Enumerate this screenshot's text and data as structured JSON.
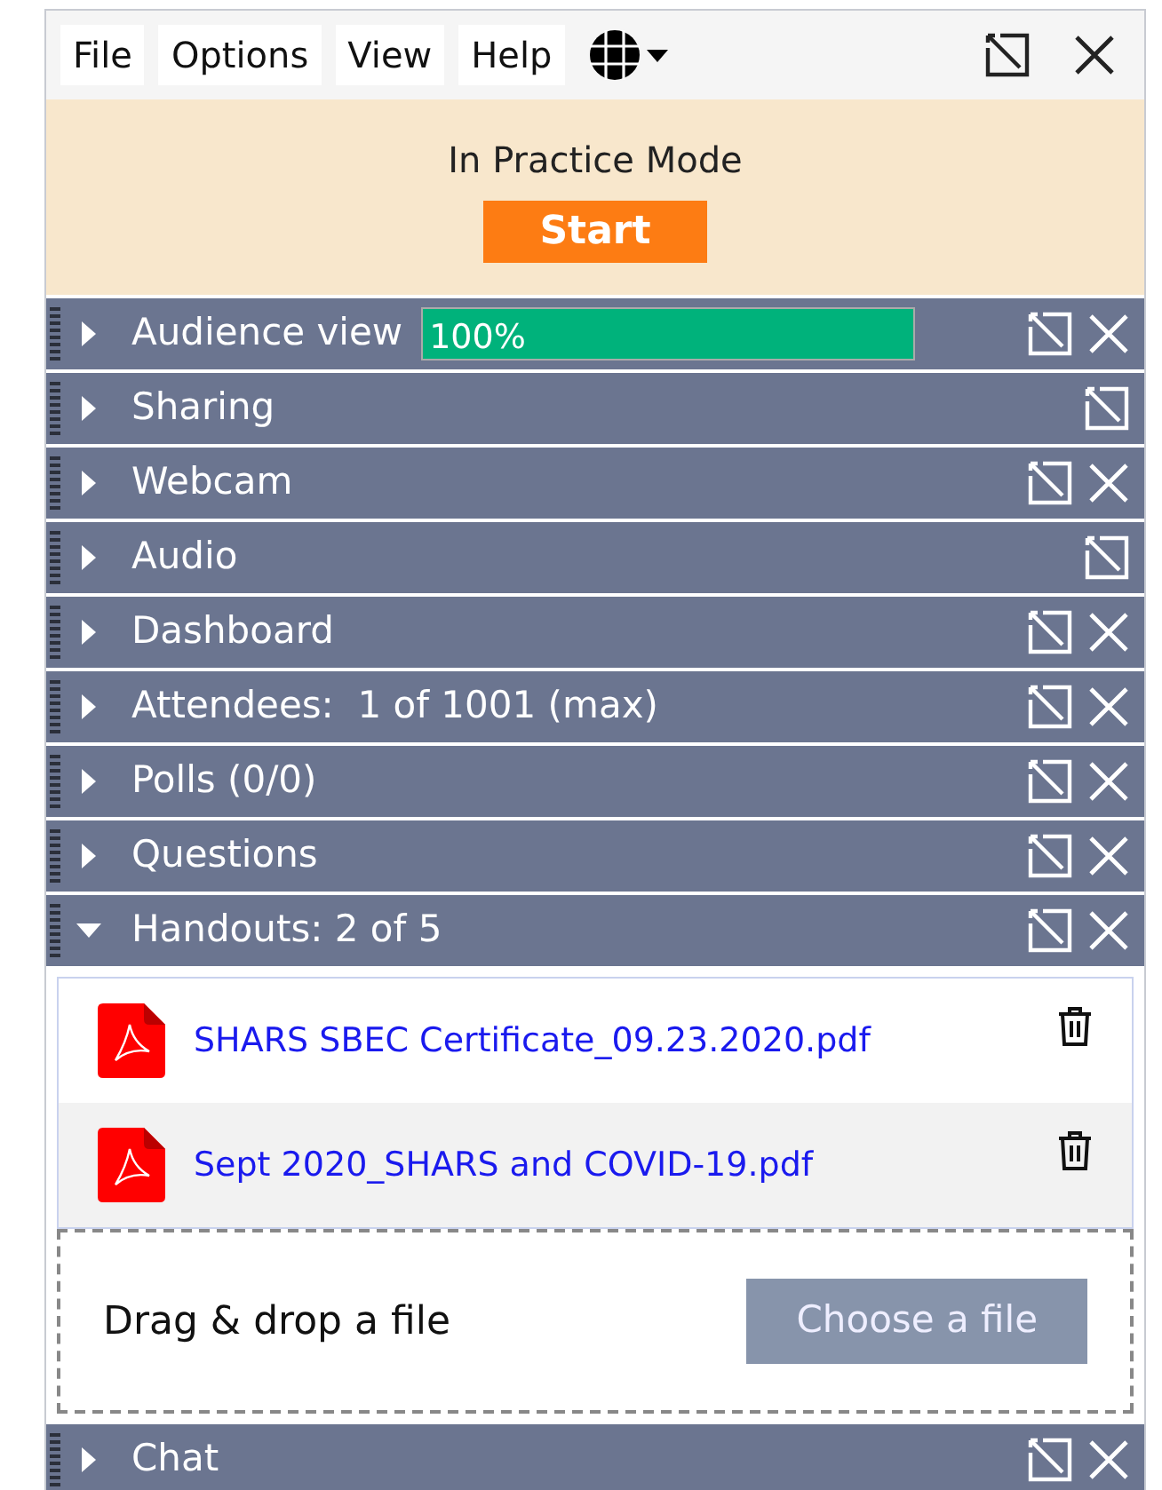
{
  "menu": [
    "File",
    "Options",
    "View",
    "Help"
  ],
  "practice": {
    "message": "In Practice Mode",
    "button": "Start"
  },
  "panels": [
    {
      "title": "Audience view",
      "expanded": false,
      "closable": true,
      "kind": "meter",
      "level": 1,
      "reading": "100%"
    },
    {
      "title": "Sharing",
      "expanded": false,
      "closable": false,
      "kind": "plain"
    },
    {
      "title": "Webcam",
      "expanded": false,
      "closable": true,
      "kind": "plain"
    },
    {
      "title": "Audio",
      "expanded": false,
      "closable": false,
      "kind": "plain"
    },
    {
      "title": "Dashboard",
      "expanded": false,
      "closable": true,
      "kind": "plain"
    },
    {
      "title": "Attendees:  1 of 1001 (max)",
      "expanded": false,
      "closable": true,
      "kind": "plain"
    },
    {
      "title": "Polls (0/0)",
      "expanded": false,
      "closable": true,
      "kind": "plain"
    },
    {
      "title": "Questions",
      "expanded": false,
      "closable": true,
      "kind": "plain"
    },
    {
      "title": "Handouts: 2 of 5",
      "expanded": true,
      "closable": true,
      "kind": "handouts",
      "files": [
        {
          "name": "SHARS SBEC Certificate_09.23.2020.pdf",
          "selected": false
        },
        {
          "name": "Sept 2020_SHARS and COVID-19.pdf",
          "selected": true
        }
      ],
      "drop_label": "Drag & drop a file",
      "choose_button": "Choose a file"
    },
    {
      "title": "Chat",
      "expanded": false,
      "closable": true,
      "kind": "plain"
    }
  ]
}
